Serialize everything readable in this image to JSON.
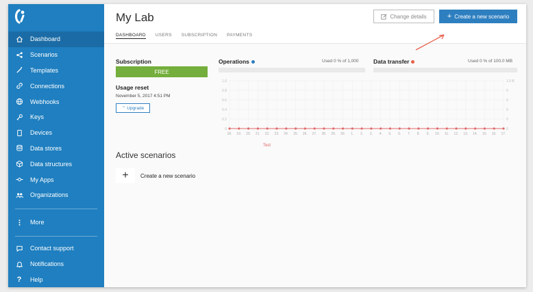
{
  "sidebar": {
    "items": [
      {
        "label": "Dashboard",
        "icon": "home-icon"
      },
      {
        "label": "Scenarios",
        "icon": "share-icon"
      },
      {
        "label": "Templates",
        "icon": "wand-icon"
      },
      {
        "label": "Connections",
        "icon": "link-icon"
      },
      {
        "label": "Webhooks",
        "icon": "globe-icon"
      },
      {
        "label": "Keys",
        "icon": "key-icon"
      },
      {
        "label": "Devices",
        "icon": "device-icon"
      },
      {
        "label": "Data stores",
        "icon": "database-icon"
      },
      {
        "label": "Data structures",
        "icon": "cube-icon"
      },
      {
        "label": "My Apps",
        "icon": "apps-icon"
      },
      {
        "label": "Organizations",
        "icon": "users-icon"
      }
    ],
    "more": "More",
    "bottom": [
      {
        "label": "Contact support",
        "icon": "chat-icon"
      },
      {
        "label": "Notifications",
        "icon": "bell-icon"
      },
      {
        "label": "Help",
        "icon": "question-icon"
      }
    ]
  },
  "header": {
    "title": "My Lab",
    "tabs": [
      "DASHBOARD",
      "USERS",
      "SUBSCRIPTION",
      "PAYMENTS"
    ],
    "change_details": "Change details",
    "create_scenario": "Create a new scenario"
  },
  "subscription": {
    "label": "Subscription",
    "plan": "FREE",
    "reset_label": "Usage reset",
    "reset_date": "November 5, 2017 4:51 PM",
    "upgrade": "Upgrade"
  },
  "operations": {
    "label": "Operations",
    "used": "Used 0 % of 1,000"
  },
  "data_transfer": {
    "label": "Data transfer",
    "used": "Used 0 % of 100.0 MB"
  },
  "chart_data": {
    "type": "line",
    "x": [
      "18.",
      "19.",
      "20.",
      "21.",
      "22.",
      "23.",
      "24.",
      "25.",
      "26.",
      "27.",
      "28.",
      "29.",
      "30.",
      "1.",
      "2.",
      "3.",
      "4.",
      "5.",
      "6.",
      "7.",
      "8.",
      "9.",
      "10.",
      "11.",
      "12.",
      "13.",
      "14.",
      "15.",
      "16.",
      "17."
    ],
    "series": [
      {
        "name": "Test",
        "values": [
          0,
          0,
          0,
          0,
          0,
          0,
          0,
          0,
          0,
          0,
          0,
          0,
          0,
          0,
          0,
          0,
          0,
          0,
          0,
          0,
          0,
          0,
          0,
          0,
          0,
          0,
          0,
          0,
          0,
          0
        ]
      }
    ],
    "y_left_ticks": [
      "1.0",
      "0.8",
      "0.6",
      "0.4",
      "0.2",
      "0"
    ],
    "y_right_ticks": [
      "1.0 B",
      "0",
      "0",
      "0",
      "0",
      "0"
    ],
    "ylim": [
      0,
      1
    ],
    "grid": true,
    "color": "#e06a6a"
  },
  "active": {
    "title": "Active scenarios",
    "create_label": "Create a new scenario"
  },
  "colors": {
    "sidebar": "#1f7fc0",
    "accent": "#2e7fc0",
    "free": "#74ae3c",
    "ops_dot": "#2e7fc0",
    "dt_dot": "#e8604c"
  }
}
